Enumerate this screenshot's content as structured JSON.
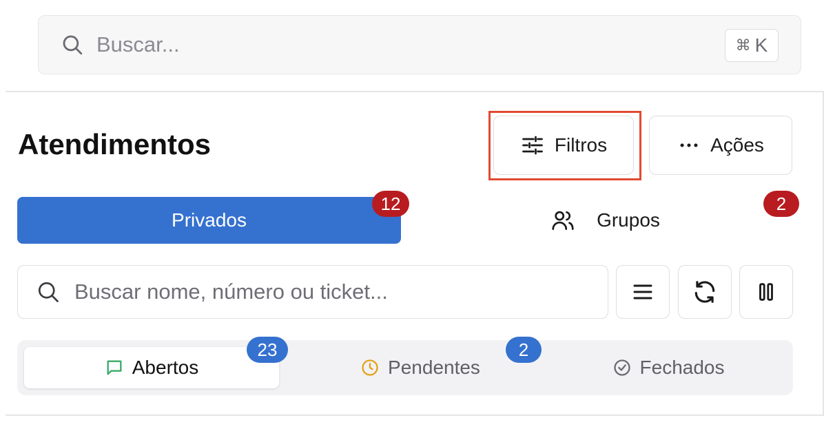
{
  "global_search": {
    "placeholder": "Buscar...",
    "shortcut_symbol": "⌘",
    "shortcut_key": "K"
  },
  "header": {
    "title": "Atendimentos",
    "filters_label": "Filtros",
    "actions_label": "Ações"
  },
  "channel_tabs": [
    {
      "label": "Privados",
      "count": "12",
      "active": true
    },
    {
      "label": "Grupos",
      "count": "2",
      "active": false
    }
  ],
  "list_search": {
    "placeholder": "Buscar nome, número ou ticket..."
  },
  "status_tabs": [
    {
      "label": "Abertos",
      "count": "23",
      "icon": "message-icon",
      "color": "#3aaa6a"
    },
    {
      "label": "Pendentes",
      "count": "2",
      "icon": "clock-icon",
      "color": "#e3a21a"
    },
    {
      "label": "Fechados",
      "icon": "check-circle-icon",
      "color": "#6b6b72"
    }
  ],
  "colors": {
    "primary": "#3571cf",
    "badge_red": "#b81c20",
    "highlight": "#e24a32"
  }
}
